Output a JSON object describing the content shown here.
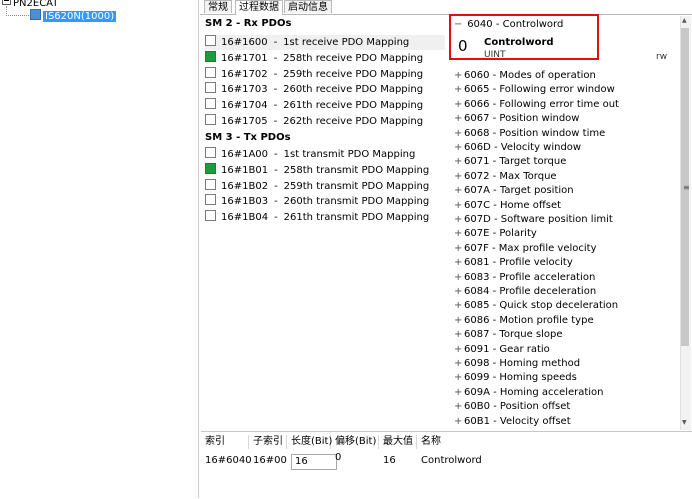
{
  "tree": {
    "root_label": "PN2ECAT",
    "device_label": "IS620N(1000)"
  },
  "tabs": [
    {
      "label": "常规"
    },
    {
      "label": "过程数据"
    },
    {
      "label": "启动信息"
    }
  ],
  "rx": {
    "header": "SM 2 - Rx PDOs",
    "items": [
      {
        "index": "16#1600",
        "sep": "-",
        "name": "1st receive PDO Mapping",
        "checked": false
      },
      {
        "index": "16#1701",
        "sep": "-",
        "name": "258th receive PDO Mapping",
        "checked": true
      },
      {
        "index": "16#1702",
        "sep": "-",
        "name": "259th receive PDO Mapping",
        "checked": false
      },
      {
        "index": "16#1703",
        "sep": "-",
        "name": "260th receive PDO Mapping",
        "checked": false
      },
      {
        "index": "16#1704",
        "sep": "-",
        "name": "261th receive PDO Mapping",
        "checked": false
      },
      {
        "index": "16#1705",
        "sep": "-",
        "name": "262th receive PDO Mapping",
        "checked": false
      }
    ]
  },
  "tx": {
    "header": "SM 3 - Tx PDOs",
    "items": [
      {
        "index": "16#1A00",
        "sep": "-",
        "name": "1st transmit PDO Mapping",
        "checked": false
      },
      {
        "index": "16#1B01",
        "sep": "-",
        "name": "258th transmit PDO Mapping",
        "checked": true
      },
      {
        "index": "16#1B02",
        "sep": "-",
        "name": "259th transmit PDO Mapping",
        "checked": false
      },
      {
        "index": "16#1B03",
        "sep": "-",
        "name": "260th transmit PDO Mapping",
        "checked": false
      },
      {
        "index": "16#1B04",
        "sep": "-",
        "name": "261th transmit PDO Mapping",
        "checked": false
      }
    ]
  },
  "objects": {
    "expanded": {
      "sign": "−",
      "label": "6040 - Controlword",
      "value": "0",
      "name": "Controlword",
      "type": "UINT",
      "access": "rw"
    },
    "items": [
      {
        "sign": "+",
        "label": "6060 - Modes of operation"
      },
      {
        "sign": "+",
        "label": "6065 - Following error window"
      },
      {
        "sign": "+",
        "label": "6066 - Following error time out"
      },
      {
        "sign": "+",
        "label": "6067 - Position window"
      },
      {
        "sign": "+",
        "label": "6068 - Position window time"
      },
      {
        "sign": "+",
        "label": "606D - Velocity window"
      },
      {
        "sign": "+",
        "label": "6071 - Target torque"
      },
      {
        "sign": "+",
        "label": "6072 - Max Torque"
      },
      {
        "sign": "+",
        "label": "607A - Target position"
      },
      {
        "sign": "+",
        "label": "607C - Home offset"
      },
      {
        "sign": "+",
        "label": "607D - Software position limit"
      },
      {
        "sign": "+",
        "label": "607E - Polarity"
      },
      {
        "sign": "+",
        "label": "607F - Max profile velocity"
      },
      {
        "sign": "+",
        "label": "6081 - Profile velocity"
      },
      {
        "sign": "+",
        "label": "6083 - Profile acceleration"
      },
      {
        "sign": "+",
        "label": "6084 - Profile deceleration"
      },
      {
        "sign": "+",
        "label": "6085 - Quick stop deceleration"
      },
      {
        "sign": "+",
        "label": "6086 - Motion profile type"
      },
      {
        "sign": "+",
        "label": "6087 - Torque slope"
      },
      {
        "sign": "+",
        "label": "6091 - Gear ratio"
      },
      {
        "sign": "+",
        "label": "6098 - Homing method"
      },
      {
        "sign": "+",
        "label": "6099 - Homing speeds"
      },
      {
        "sign": "+",
        "label": "609A - Homing acceleration"
      },
      {
        "sign": "+",
        "label": "60B0 - Position offset"
      },
      {
        "sign": "+",
        "label": "60B1 - Velocity offset"
      }
    ]
  },
  "table": {
    "headers": [
      "索引",
      "子索引",
      "长度(Bit)",
      "偏移(Bit)",
      "最大值",
      "名称"
    ],
    "row": [
      "16#6040",
      "16#00",
      "16",
      "0",
      "16",
      "Controlword"
    ]
  },
  "colors": {
    "highlight_border": "#e01010",
    "checked_box": "#1e9c3c",
    "tree_selected": "#3399ff"
  }
}
